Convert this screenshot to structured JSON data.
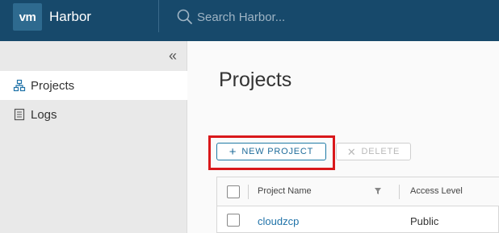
{
  "header": {
    "logo": "vm",
    "title": "Harbor",
    "search_placeholder": "Search Harbor..."
  },
  "sidebar": {
    "items": [
      {
        "label": "Projects",
        "icon": "projects-icon",
        "active": true
      },
      {
        "label": "Logs",
        "icon": "logs-icon",
        "active": false
      }
    ]
  },
  "main": {
    "title": "Projects",
    "new_project_label": "NEW PROJECT",
    "delete_label": "DELETE",
    "table": {
      "columns": [
        "Project Name",
        "Access Level"
      ],
      "rows": [
        {
          "name": "cloudzcp",
          "access": "Public"
        }
      ]
    }
  },
  "colors": {
    "header_bg": "#17496b",
    "accent": "#1f72a8",
    "highlight": "#d9181b"
  }
}
